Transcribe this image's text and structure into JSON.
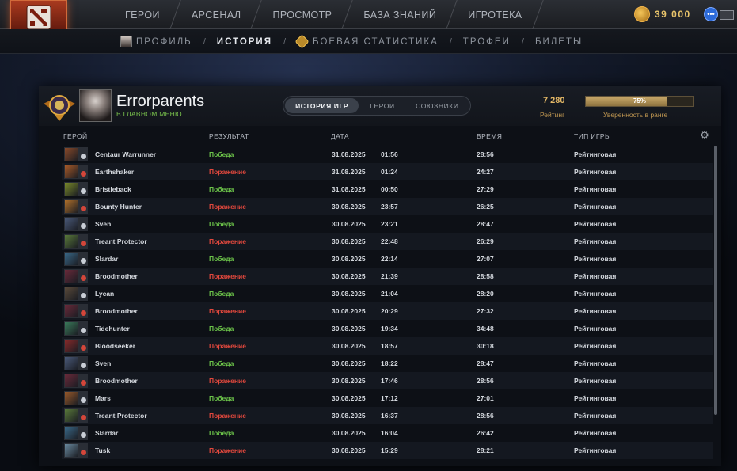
{
  "topnav": {
    "tabs": [
      "ГЕРОИ",
      "АРСЕНАЛ",
      "ПРОСМОТР",
      "БАЗА ЗНАНИЙ",
      "ИГРОТЕКА"
    ],
    "currency": "39 000"
  },
  "subnav": {
    "profile": "ПРОФИЛЬ",
    "history": "ИСТОРИЯ",
    "stats": "БОЕВАЯ СТАТИСТИКА",
    "trophies": "ТРОФЕИ",
    "tickets": "БИЛЕТЫ",
    "sep": "/"
  },
  "profile": {
    "username": "Errorparents",
    "status": "В ГЛАВНОМ МЕНЮ"
  },
  "segments": [
    "ИСТОРИЯ ИГР",
    "ГЕРОИ",
    "СОЮЗНИКИ"
  ],
  "rating": {
    "value": "7 280",
    "label": "Рейтинг"
  },
  "confidence": {
    "value": "75%",
    "fraction": 0.75,
    "label": "Уверенность в ранге"
  },
  "columns": {
    "hero": "ГЕРОЙ",
    "result": "РЕЗУЛЬТАТ",
    "date": "ДАТА",
    "duration": "ВРЕМЯ",
    "type": "ТИП ИГРЫ"
  },
  "matches": [
    {
      "hero": "Centaur Warrunner",
      "result": "Победа",
      "win": true,
      "date": "31.08.2025",
      "time": "01:56",
      "duration": "28:56",
      "type": "Рейтинговая",
      "color": "#8a4a2a"
    },
    {
      "hero": "Earthshaker",
      "result": "Поражение",
      "win": false,
      "date": "31.08.2025",
      "time": "01:24",
      "duration": "24:27",
      "type": "Рейтинговая",
      "color": "#a85a28"
    },
    {
      "hero": "Bristleback",
      "result": "Победа",
      "win": true,
      "date": "31.08.2025",
      "time": "00:50",
      "duration": "27:29",
      "type": "Рейтинговая",
      "color": "#7a8a2a"
    },
    {
      "hero": "Bounty Hunter",
      "result": "Поражение",
      "win": false,
      "date": "30.08.2025",
      "time": "23:57",
      "duration": "26:25",
      "type": "Рейтинговая",
      "color": "#b0702a"
    },
    {
      "hero": "Sven",
      "result": "Победа",
      "win": true,
      "date": "30.08.2025",
      "time": "23:21",
      "duration": "28:47",
      "type": "Рейтинговая",
      "color": "#4a5a7a"
    },
    {
      "hero": "Treant Protector",
      "result": "Поражение",
      "win": false,
      "date": "30.08.2025",
      "time": "22:48",
      "duration": "26:29",
      "type": "Рейтинговая",
      "color": "#5a7a3a"
    },
    {
      "hero": "Slardar",
      "result": "Победа",
      "win": true,
      "date": "30.08.2025",
      "time": "22:14",
      "duration": "27:07",
      "type": "Рейтинговая",
      "color": "#3a6a8a"
    },
    {
      "hero": "Broodmother",
      "result": "Поражение",
      "win": false,
      "date": "30.08.2025",
      "time": "21:39",
      "duration": "28:58",
      "type": "Рейтинговая",
      "color": "#6a2a3a"
    },
    {
      "hero": "Lycan",
      "result": "Победа",
      "win": true,
      "date": "30.08.2025",
      "time": "21:04",
      "duration": "28:20",
      "type": "Рейтинговая",
      "color": "#5a4a3a"
    },
    {
      "hero": "Broodmother",
      "result": "Поражение",
      "win": false,
      "date": "30.08.2025",
      "time": "20:29",
      "duration": "27:32",
      "type": "Рейтинговая",
      "color": "#6a2a3a"
    },
    {
      "hero": "Tidehunter",
      "result": "Победа",
      "win": true,
      "date": "30.08.2025",
      "time": "19:34",
      "duration": "34:48",
      "type": "Рейтинговая",
      "color": "#3a7a5a"
    },
    {
      "hero": "Bloodseeker",
      "result": "Поражение",
      "win": false,
      "date": "30.08.2025",
      "time": "18:57",
      "duration": "30:18",
      "type": "Рейтинговая",
      "color": "#8a2a2a"
    },
    {
      "hero": "Sven",
      "result": "Победа",
      "win": true,
      "date": "30.08.2025",
      "time": "18:22",
      "duration": "28:47",
      "type": "Рейтинговая",
      "color": "#4a5a7a"
    },
    {
      "hero": "Broodmother",
      "result": "Поражение",
      "win": false,
      "date": "30.08.2025",
      "time": "17:46",
      "duration": "28:56",
      "type": "Рейтинговая",
      "color": "#6a2a3a"
    },
    {
      "hero": "Mars",
      "result": "Победа",
      "win": true,
      "date": "30.08.2025",
      "time": "17:12",
      "duration": "27:01",
      "type": "Рейтинговая",
      "color": "#9a5a2a"
    },
    {
      "hero": "Treant Protector",
      "result": "Поражение",
      "win": false,
      "date": "30.08.2025",
      "time": "16:37",
      "duration": "28:56",
      "type": "Рейтинговая",
      "color": "#5a7a3a"
    },
    {
      "hero": "Slardar",
      "result": "Победа",
      "win": true,
      "date": "30.08.2025",
      "time": "16:04",
      "duration": "26:42",
      "type": "Рейтинговая",
      "color": "#3a6a8a"
    },
    {
      "hero": "Tusk",
      "result": "Поражение",
      "win": false,
      "date": "30.08.2025",
      "time": "15:29",
      "duration": "28:21",
      "type": "Рейтинговая",
      "color": "#6a8aa0"
    }
  ]
}
